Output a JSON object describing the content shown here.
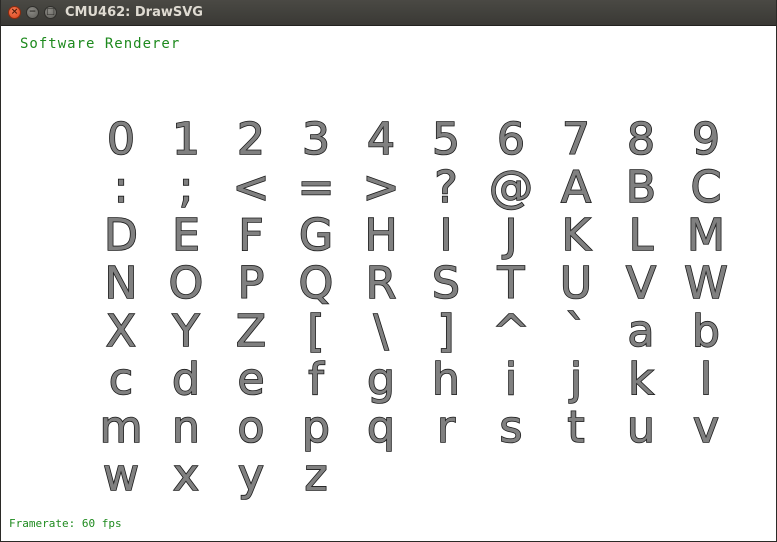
{
  "window": {
    "title": "CMU462: DrawSVG",
    "close_icon": "close-icon",
    "minimize_icon": "minimize-icon",
    "maximize_icon": "maximize-icon"
  },
  "renderer_label": "Software Renderer",
  "framerate_label": "Framerate: 60 fps",
  "glyph_fill_color": "#808080",
  "glyph_stroke_color": "#1a1a1a",
  "hud_text_color": "#1e8a1e",
  "glyph_rows": [
    [
      "0",
      "1",
      "2",
      "3",
      "4",
      "5",
      "6",
      "7",
      "8",
      "9"
    ],
    [
      ":",
      ";",
      "<",
      "=",
      ">",
      "?",
      "@",
      "A",
      "B",
      "C"
    ],
    [
      "D",
      "E",
      "F",
      "G",
      "H",
      "I",
      "J",
      "K",
      "L",
      "M"
    ],
    [
      "N",
      "O",
      "P",
      "Q",
      "R",
      "S",
      "T",
      "U",
      "V",
      "W"
    ],
    [
      "X",
      "Y",
      "Z",
      "[",
      "\\",
      "]",
      "^",
      "`",
      "a",
      "b"
    ],
    [
      "c",
      "d",
      "e",
      "f",
      "g",
      "h",
      "i",
      "j",
      "k",
      "l"
    ],
    [
      "m",
      "n",
      "o",
      "p",
      "q",
      "r",
      "s",
      "t",
      "u",
      "v"
    ],
    [
      "w",
      "x",
      "y",
      "z"
    ]
  ]
}
